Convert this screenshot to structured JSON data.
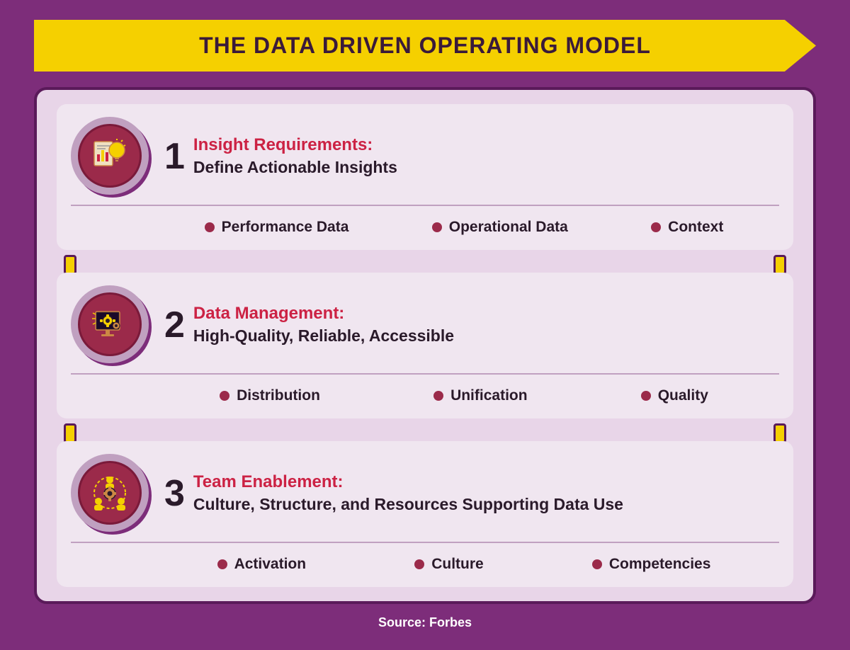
{
  "title": "THE DATA DRIVEN OPERATING MODEL",
  "rows": [
    {
      "number": "1",
      "heading_label": "Insight Requirements:",
      "heading_sub": "Define Actionable Insights",
      "bullets": [
        "Performance Data",
        "Operational Data",
        "Context"
      ],
      "icon": "insights"
    },
    {
      "number": "2",
      "heading_label": "Data Management:",
      "heading_sub": "High-Quality, Reliable, Accessible",
      "bullets": [
        "Distribution",
        "Unification",
        "Quality"
      ],
      "icon": "management"
    },
    {
      "number": "3",
      "heading_label": "Team Enablement:",
      "heading_sub": "Culture, Structure, and Resources Supporting Data Use",
      "bullets": [
        "Activation",
        "Culture",
        "Competencies"
      ],
      "icon": "team"
    }
  ],
  "source_label": "Source:",
  "source_value": "Forbes"
}
